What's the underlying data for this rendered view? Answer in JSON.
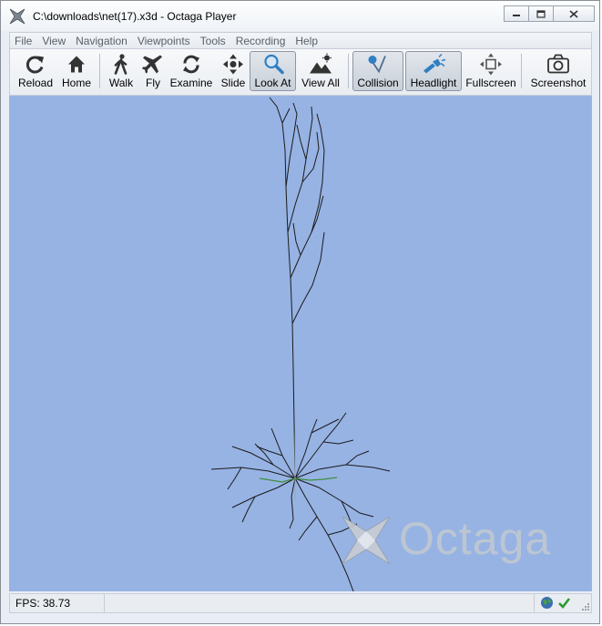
{
  "window": {
    "title": "C:\\downloads\\net(17).x3d - Octaga Player",
    "controls": [
      "minimize",
      "maximize",
      "close"
    ]
  },
  "menu": [
    "File",
    "View",
    "Navigation",
    "Viewpoints",
    "Tools",
    "Recording",
    "Help"
  ],
  "toolbar": {
    "reload": "Reload",
    "home": "Home",
    "walk": "Walk",
    "fly": "Fly",
    "examine": "Examine",
    "slide": "Slide",
    "lookat": "Look At",
    "viewall": "View All",
    "collision": "Collision",
    "headlight": "Headlight",
    "fullscreen": "Fullscreen",
    "screenshot": "Screenshot",
    "active": [
      "Look At",
      "Collision",
      "Headlight"
    ]
  },
  "viewport": {
    "background": "#97b3e4",
    "watermark": "Octaga"
  },
  "status": {
    "fps": "FPS: 38.73",
    "icons": [
      "globe-icon",
      "checkmark-icon"
    ]
  }
}
